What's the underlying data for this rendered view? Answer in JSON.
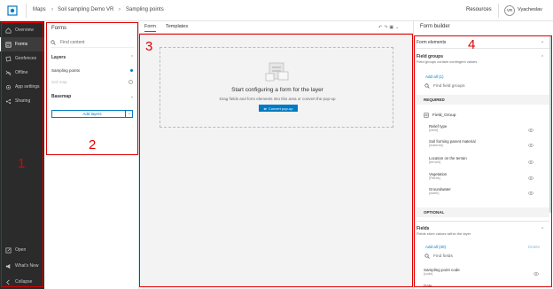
{
  "topbar": {
    "breadcrumbs": [
      "Maps",
      "Soil sampling Demo VR",
      "Sampling points"
    ],
    "resources": "Resources",
    "avatar_initials": "VR",
    "user_name": "Vyacheslav"
  },
  "leftnav": {
    "items": [
      {
        "label": "Overview",
        "icon": "home-icon"
      },
      {
        "label": "Forms",
        "icon": "form-icon",
        "active": true
      },
      {
        "label": "Geofences",
        "icon": "geofence-icon"
      },
      {
        "label": "Offline",
        "icon": "offline-icon"
      },
      {
        "label": "App settings",
        "icon": "gear-icon"
      },
      {
        "label": "Sharing",
        "icon": "share-icon"
      }
    ],
    "bottom": [
      {
        "label": "Open",
        "icon": "open-icon"
      },
      {
        "label": "What's New",
        "icon": "megaphone-icon"
      },
      {
        "label": "Collapse",
        "icon": "collapse-icon"
      }
    ]
  },
  "forms_panel": {
    "title": "Forms",
    "search_placeholder": "Find content",
    "layers_heading": "Layers",
    "layers": [
      {
        "label": "Sampling points",
        "state": "active"
      },
      {
        "label": "Soil map",
        "state": "disabled"
      }
    ],
    "basemap_heading": "Basemap",
    "add_layers": "Add layers"
  },
  "tabs": [
    {
      "label": "Form",
      "active": true
    },
    {
      "label": "Templates",
      "active": false
    }
  ],
  "canvas": {
    "title": "Start configuring a form for the layer",
    "subtitle": "Drag fields and form elements into this area or convert the pop-up",
    "button": "Convert pop-up"
  },
  "builder": {
    "title": "Form builder",
    "form_elements": "Form elements",
    "field_groups": {
      "title": "Field groups",
      "subtitle": "Field groups contain contingent values",
      "link": "Add all (1)",
      "search_placeholder": "Find field groups",
      "required_label": "REQUIRED",
      "group_name": "Field_Group",
      "fields": [
        {
          "label": "Relief type",
          "sub": "[relief]"
        },
        {
          "label": "Soil forming parent material",
          "sub": "[material]"
        },
        {
          "label": "Location on the terrain",
          "sub": "[terrain]"
        },
        {
          "label": "Vegetation",
          "sub": "[Plants]"
        },
        {
          "label": "Groundwater",
          "sub": "[water]"
        }
      ],
      "optional_label": "OPTIONAL"
    },
    "fields": {
      "title": "Fields",
      "subtitle": "Fields store values within the layer",
      "link": "Add all (30)",
      "delete": "Delete",
      "search_placeholder": "Find fields",
      "items": [
        {
          "label": "Sampling point code",
          "sub": "[code]"
        }
      ],
      "partial": "Date"
    }
  },
  "annotations": [
    "1",
    "2",
    "3",
    "4"
  ],
  "colors": {
    "accent": "#007ac2",
    "nav_bg": "#2b2b2b",
    "highlight": "#e00000"
  }
}
